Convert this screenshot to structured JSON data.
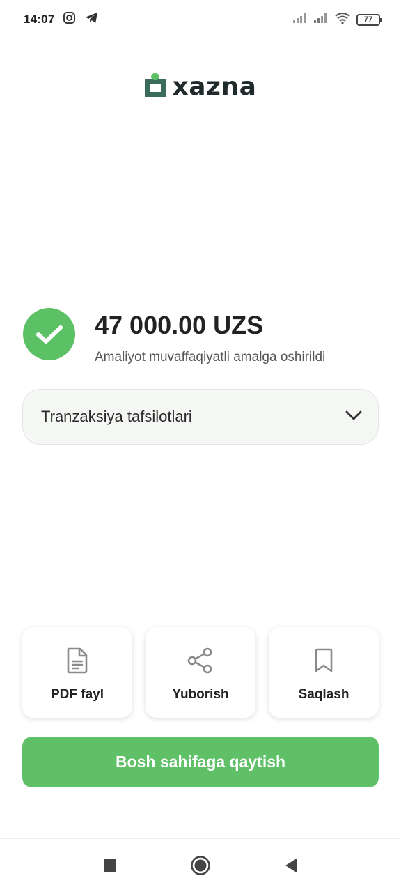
{
  "status_bar": {
    "time": "14:07",
    "battery": "77",
    "icons": [
      "instagram-icon",
      "telegram-icon",
      "signal-icon",
      "signal-icon",
      "wifi-icon",
      "battery-icon"
    ]
  },
  "brand": {
    "name": "xazna",
    "accent_color": "#3a6b5c",
    "dot_color": "#5cc065"
  },
  "result": {
    "amount": "47 000.00 UZS",
    "message": "Amaliyot muvaffaqiyatli amalga oshirildi",
    "icon": "check-icon",
    "color": "#5cc065"
  },
  "details": {
    "label": "Tranzaksiya tafsilotlari",
    "icon": "chevron-down-icon"
  },
  "actions": [
    {
      "label": "PDF fayl",
      "icon": "document-icon"
    },
    {
      "label": "Yuborish",
      "icon": "share-icon"
    },
    {
      "label": "Saqlash",
      "icon": "bookmark-icon"
    }
  ],
  "primary_button": {
    "label": "Bosh sahifaga qaytish",
    "color": "#5fc068"
  },
  "nav": {
    "icons": [
      "recent-apps-icon",
      "home-icon",
      "back-icon"
    ]
  }
}
